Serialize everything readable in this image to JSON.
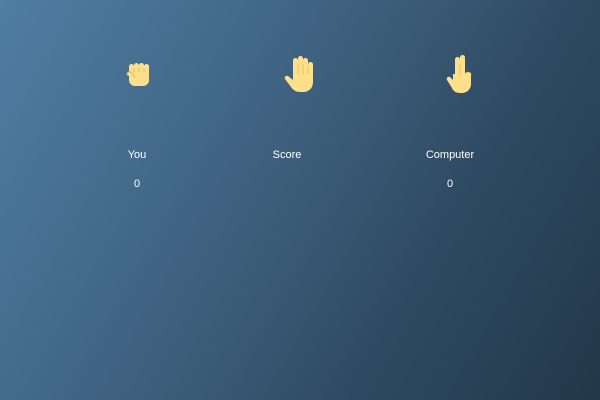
{
  "choices": [
    {
      "name": "rock",
      "icon": "raised-fist-icon"
    },
    {
      "name": "paper",
      "icon": "raised-hand-icon"
    },
    {
      "name": "scissors",
      "icon": "victory-hand-icon"
    }
  ],
  "labels": {
    "you": "You",
    "score": "Score",
    "computer": "Computer"
  },
  "scores": {
    "you": "0",
    "computer": "0"
  },
  "colors": {
    "hand": "#ffe08a",
    "hand_outline": "#e0b85a",
    "text": "#ffffff",
    "bg_start": "#4f7ea3",
    "bg_end": "#22384a"
  }
}
